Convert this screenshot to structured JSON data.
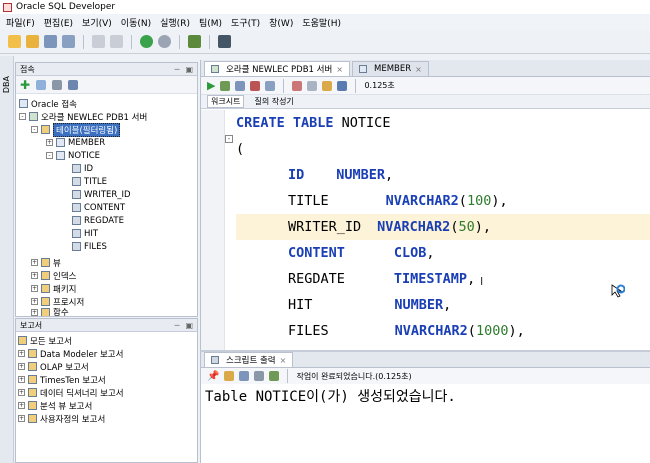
{
  "window": {
    "title": "Oracle SQL Developer"
  },
  "menu": [
    "파일(F)",
    "편집(E)",
    "보기(V)",
    "이동(N)",
    "실행(R)",
    "팀(M)",
    "도구(T)",
    "창(W)",
    "도움말(H)"
  ],
  "left_strip": {
    "label": "DBA"
  },
  "connections": {
    "header": "접속",
    "items": [
      {
        "label": "Oracle 접속"
      },
      {
        "label": "오라클 NEWLEC PDB1 서버"
      },
      {
        "label": "테이블(필터링됨)"
      },
      {
        "label": "MEMBER"
      },
      {
        "label": "NOTICE"
      },
      {
        "label": "ID"
      },
      {
        "label": "TITLE"
      },
      {
        "label": "WRITER_ID"
      },
      {
        "label": "CONTENT"
      },
      {
        "label": "REGDATE"
      },
      {
        "label": "HIT"
      },
      {
        "label": "FILES"
      },
      {
        "label": "뷰"
      },
      {
        "label": "인덱스"
      },
      {
        "label": "패키지"
      },
      {
        "label": "프로시저"
      },
      {
        "label": "함수"
      }
    ]
  },
  "reports": {
    "header": "보고서",
    "items": [
      {
        "label": "모든 보고서"
      },
      {
        "label": "Data Modeler 보고서"
      },
      {
        "label": "OLAP 보고서"
      },
      {
        "label": "TimesTen 보고서"
      },
      {
        "label": "데이터 딕셔너리 보고서"
      },
      {
        "label": "분석 뷰 보고서"
      },
      {
        "label": "사용자정의 보고서"
      }
    ]
  },
  "editor": {
    "tabs": [
      {
        "label": "오라클 NEWLEC PDB1 서버"
      },
      {
        "label": "MEMBER"
      }
    ],
    "timing": "0.125초",
    "subtabs": {
      "worksheet": "워크시트",
      "query_builder": "질의 작성기"
    },
    "code": {
      "l1_kw": "CREATE TABLE",
      "l1_rest": " NOTICE",
      "l2": "(",
      "l3_col": "ID",
      "l3_type": "NUMBER",
      "l4_col": "TITLE",
      "l4_type": "NVARCHAR2",
      "l4_num": "100",
      "l5_col": "WRITER_ID",
      "l5_type": "NVARCHAR2",
      "l5_num": "50",
      "l6_col": "CONTENT",
      "l6_type": "CLOB",
      "l7_col": "REGDATE",
      "l7_type": "TIMESTAMP",
      "l8_col": "HIT",
      "l8_type": "NUMBER",
      "l9_col": "FILES",
      "l9_type": "NVARCHAR2",
      "l9_num": "1000"
    }
  },
  "script_output": {
    "tab_label": "스크립트 출력",
    "status": "작업이 완료되었습니다.(0.125초)",
    "output": "Table NOTICE이(가) 생성되었습니다."
  }
}
